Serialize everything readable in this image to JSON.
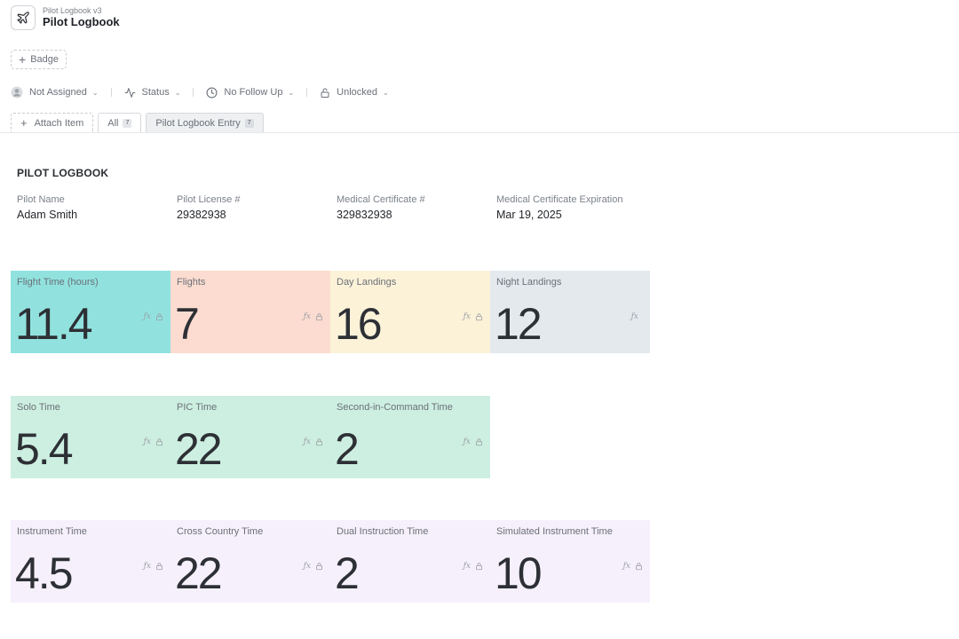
{
  "header": {
    "subtitle": "Pilot Logbook v3",
    "title": "Pilot Logbook",
    "icon": "airplane-icon"
  },
  "badge_button": {
    "label": "Badge"
  },
  "filters": [
    {
      "label": "Not Assigned",
      "icon": "user-icon"
    },
    {
      "label": "Status",
      "icon": "activity-icon"
    },
    {
      "label": "No Follow Up",
      "icon": "clock-icon"
    },
    {
      "label": "Unlocked",
      "icon": "lock-icon"
    }
  ],
  "tabs": {
    "attach_label": "Attach Item",
    "all": {
      "label": "All",
      "count": "7"
    },
    "entry": {
      "label": "Pilot Logbook Entry",
      "count": "7"
    }
  },
  "section_title": "PILOT LOGBOOK",
  "info": [
    {
      "label": "Pilot Name",
      "value": "Adam Smith"
    },
    {
      "label": "Pilot License #",
      "value": "29382938"
    },
    {
      "label": "Medical Certificate #",
      "value": "329832938"
    },
    {
      "label": "Medical Certificate Expiration",
      "value": "Mar 19, 2025"
    }
  ],
  "colors": {
    "teal": "#91e2df",
    "salmon": "#fcdcd0",
    "cream": "#fbf2d8",
    "grey": "#e4e9ed",
    "mint": "#cdefe1",
    "lavender": "#f6f0fc"
  },
  "rows": [
    [
      {
        "label": "Flight Time (hours)",
        "value": "11.4",
        "color": "#91e2df",
        "lock": true
      },
      {
        "label": "Flights",
        "value": "7",
        "color": "#fcdcd0",
        "lock": true
      },
      {
        "label": "Day Landings",
        "value": "16",
        "color": "#fbf2d8",
        "lock": true
      },
      {
        "label": "Night Landings",
        "value": "12",
        "color": "#e4e9ed",
        "lock": false
      }
    ],
    [
      {
        "label": "Solo Time",
        "value": "5.4",
        "color": "#cdefe1",
        "lock": true
      },
      {
        "label": "PIC Time",
        "value": "22",
        "color": "#cdefe1",
        "lock": true
      },
      {
        "label": "Second-in-Command Time",
        "value": "2",
        "color": "#cdefe1",
        "lock": true
      }
    ],
    [
      {
        "label": "Instrument Time",
        "value": "4.5",
        "color": "#f6f0fc",
        "lock": true
      },
      {
        "label": "Cross Country Time",
        "value": "22",
        "color": "#f6f0fc",
        "lock": true
      },
      {
        "label": "Dual Instruction Time",
        "value": "2",
        "color": "#f6f0fc",
        "lock": true
      },
      {
        "label": "Simulated Instrument Time",
        "value": "10",
        "color": "#f6f0fc",
        "lock": true
      }
    ]
  ]
}
